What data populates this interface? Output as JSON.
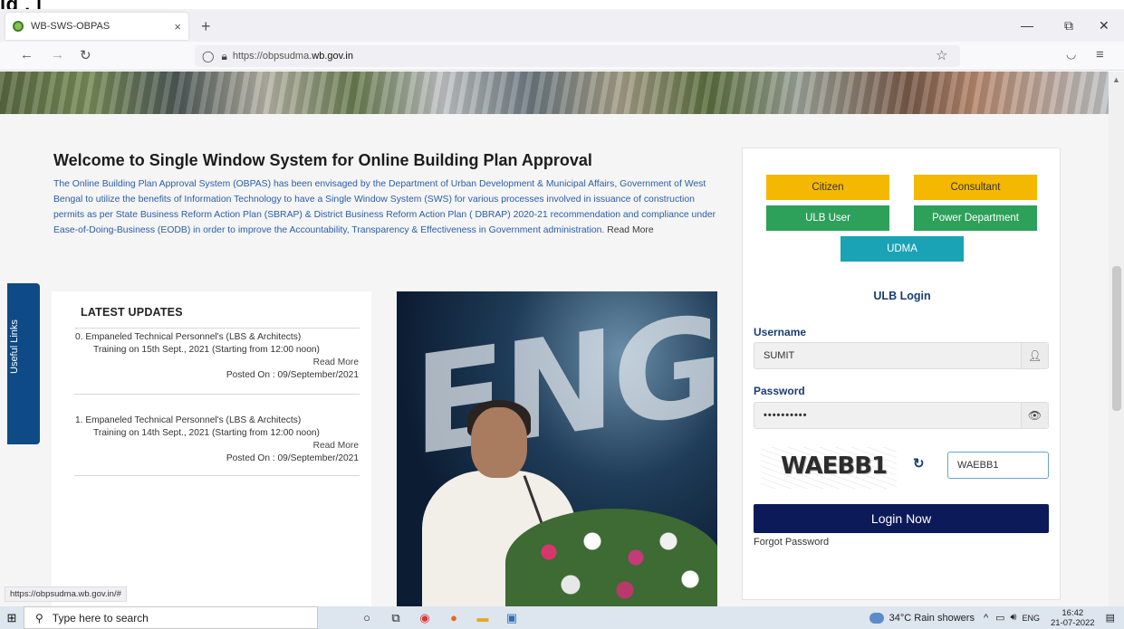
{
  "crop_title": "lg . [",
  "browser": {
    "tab_title": "WB-SWS-OBPAS",
    "tab_close": "×",
    "new_tab": "+",
    "minimize": "—",
    "restore": "⧉",
    "close": "✕",
    "url_prefix": "https://obpsudma.",
    "url_host": "wb.gov.in",
    "status_url": "https://obpsudma.wb.gov.in/#"
  },
  "page": {
    "welcome_title": "Welcome to Single Window System for Online Building Plan Approval",
    "welcome_text": "The Online Building Plan Approval System (OBPAS) has been envisaged by the Department of Urban Development & Municipal Affairs, Government of West Bengal to utilize the benefits of Information Technology to have a Single Window System (SWS) for various processes involved in issuance of construction permits as per State Business Reform Action Plan (SBRAP) & District Business Reform Action Plan ( DBRAP) 2020-21 recommendation and compliance under Ease-of-Doing-Business (EODB) in order to improve the Accountability, Transparency & Effectiveness in Government administration.",
    "welcome_read_more": "Read More",
    "useful_links": "Useful Links",
    "latest_updates": {
      "heading": "LATEST UPDATES",
      "items": [
        {
          "title": "0. Empaneled Technical Personnel's (LBS & Architects)",
          "subtitle": "Training on 15th Sept., 2021 (Starting from 12:00 noon)",
          "read_more": "Read More",
          "posted": "Posted On : 09/September/2021"
        },
        {
          "title": "1. Empaneled Technical Personnel's (LBS & Architects)",
          "subtitle": "Training on 14th Sept., 2021 (Starting from 12:00 noon)",
          "read_more": "Read More",
          "posted": "Posted On : 09/September/2021"
        }
      ]
    }
  },
  "login": {
    "roles": {
      "citizen": "Citizen",
      "consultant": "Consultant",
      "ulb_user": "ULB User",
      "power_department": "Power Department",
      "udma": "UDMA"
    },
    "heading": "ULB Login",
    "username_label": "Username",
    "username_value": "SUMIT",
    "password_label": "Password",
    "password_value": "••••••••••",
    "captcha_text": "WAEBB1",
    "captcha_input": "WAEBB1",
    "login_button": "Login Now",
    "forgot_password": "Forgot Password"
  },
  "taskbar": {
    "search_placeholder": "Type here to search",
    "weather": "34°C  Rain showers",
    "lang": "ENG",
    "time": "16:42",
    "date": "21-07-2022"
  },
  "colors": {
    "yellow_button": "#f5b800",
    "green_button": "#2da05a",
    "teal_button": "#1aa2b5",
    "login_button": "#0c1a5a",
    "useful_links_tab": "#0e4a86",
    "heading_blue": "#1a3d75",
    "body_link_blue": "#2a5ea8"
  }
}
